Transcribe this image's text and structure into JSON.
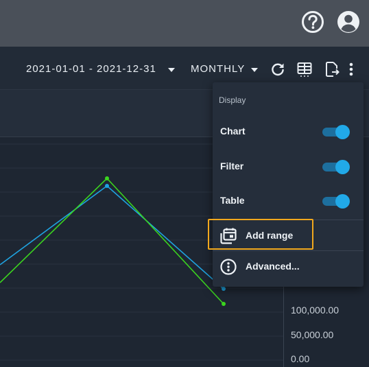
{
  "header": {
    "help_icon": "help-circle-icon",
    "account_icon": "account-circle-icon"
  },
  "toolbar": {
    "date_range": "2021-01-01 - 2021-12-31",
    "period": "MONTHLY",
    "icons": [
      "refresh-icon",
      "table-view-icon",
      "export-icon",
      "more-vert-icon"
    ]
  },
  "chart": {
    "y_axis_labels": [
      "100,000.00",
      "50,000.00",
      "0.00"
    ],
    "series_colors": [
      "#1fa3e0",
      "#3bd41f"
    ]
  },
  "menu": {
    "section_header": "Display",
    "toggles": [
      {
        "label": "Chart",
        "on": true
      },
      {
        "label": "Filter",
        "on": true
      },
      {
        "label": "Table",
        "on": true
      }
    ],
    "add_range_label": "Add range",
    "advanced_label": "Advanced..."
  },
  "colors": {
    "accent": "#21a9e8",
    "highlight": "#f2a81d"
  }
}
